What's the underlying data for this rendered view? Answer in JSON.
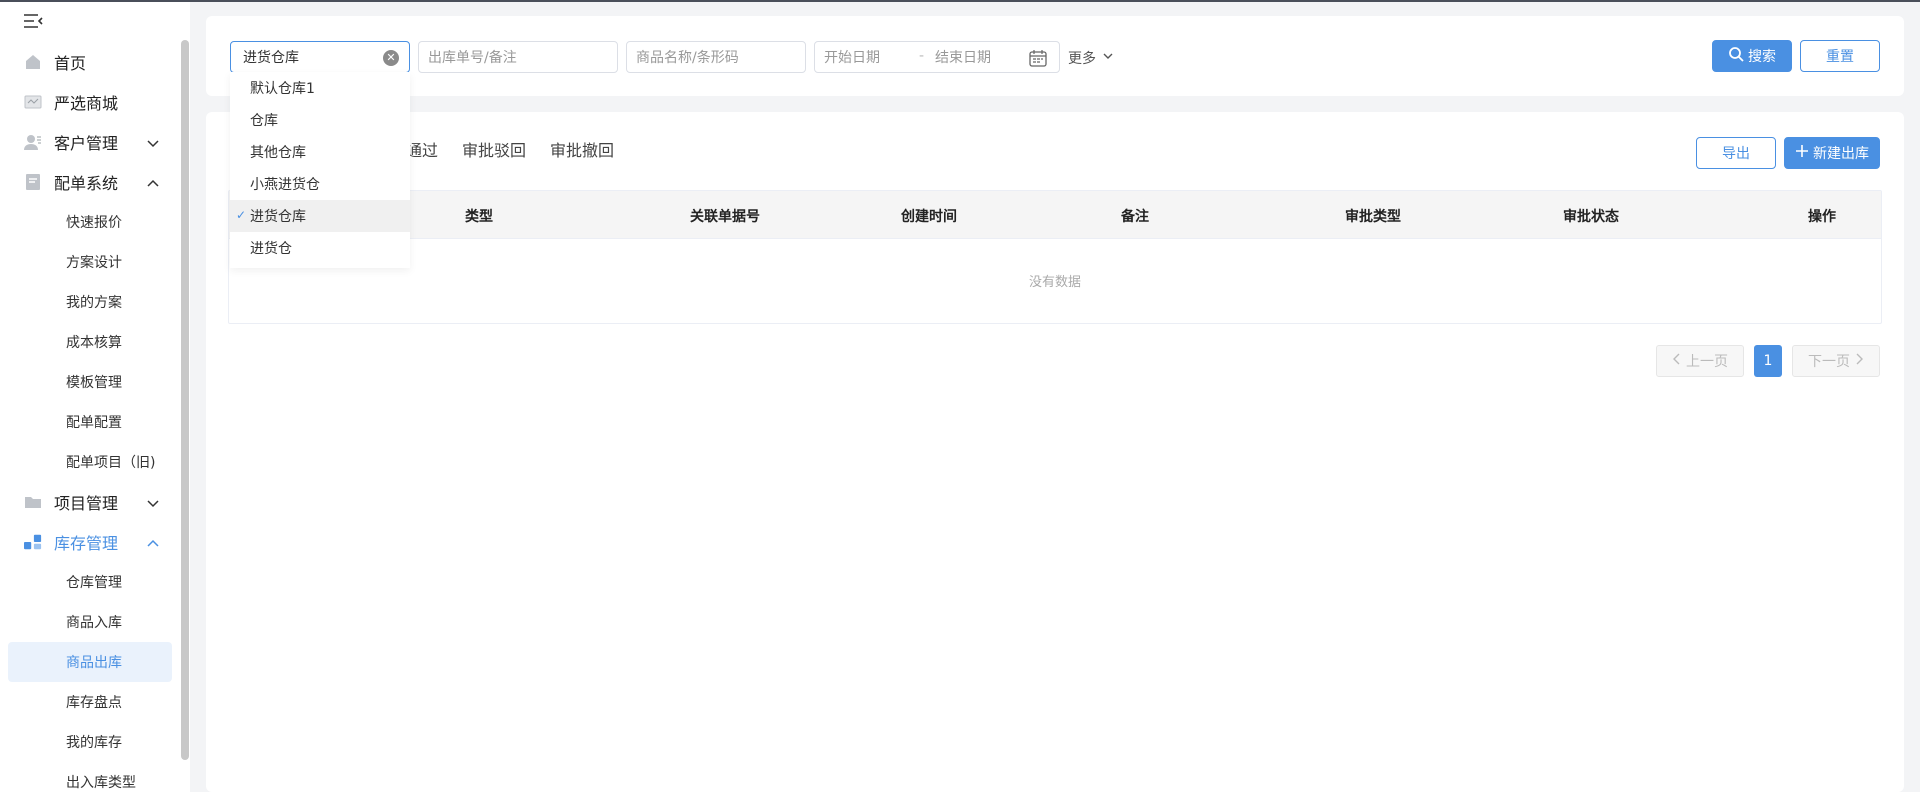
{
  "sidebar": {
    "items": [
      {
        "label": "首页",
        "icon": "home-icon"
      },
      {
        "label": "严选商城",
        "icon": "shop-icon"
      },
      {
        "label": "客户管理",
        "icon": "customer-icon"
      },
      {
        "label": "配单系统",
        "icon": "document-icon"
      },
      {
        "label": "项目管理",
        "icon": "folder-icon"
      },
      {
        "label": "库存管理",
        "icon": "inventory-icon"
      }
    ],
    "order_sub": [
      "快速报价",
      "方案设计",
      "我的方案",
      "成本核算",
      "模板管理",
      "配单配置",
      "配单项目（旧)"
    ],
    "stock_sub": [
      "仓库管理",
      "商品入库",
      "商品出库",
      "库存盘点",
      "我的库存",
      "出入库类型"
    ],
    "accent": "#4a90e2"
  },
  "filter": {
    "warehouse_value": "进货仓库",
    "order_placeholder": "出库单号/备注",
    "product_placeholder": "商品名称/条形码",
    "start_date_placeholder": "开始日期",
    "date_separator": "-",
    "end_date_placeholder": "结束日期",
    "more_label": "更多",
    "search_label": "搜索",
    "reset_label": "重置"
  },
  "dropdown": {
    "options": [
      "默认仓库1",
      "仓库",
      "其他仓库",
      "小燕进货仓",
      "进货仓库",
      "进货仓"
    ],
    "selected": "进货仓库"
  },
  "tabs": [
    "通过",
    "审批驳回",
    "审批撤回"
  ],
  "actions": {
    "export_label": "导出",
    "new_label": "新建出库"
  },
  "table": {
    "columns": [
      "类型",
      "关联单据号",
      "创建时间",
      "备注",
      "审批类型",
      "审批状态",
      "操作"
    ],
    "empty_text": "没有数据"
  },
  "pagination": {
    "prev_label": "上一页",
    "current": "1",
    "next_label": "下一页"
  }
}
